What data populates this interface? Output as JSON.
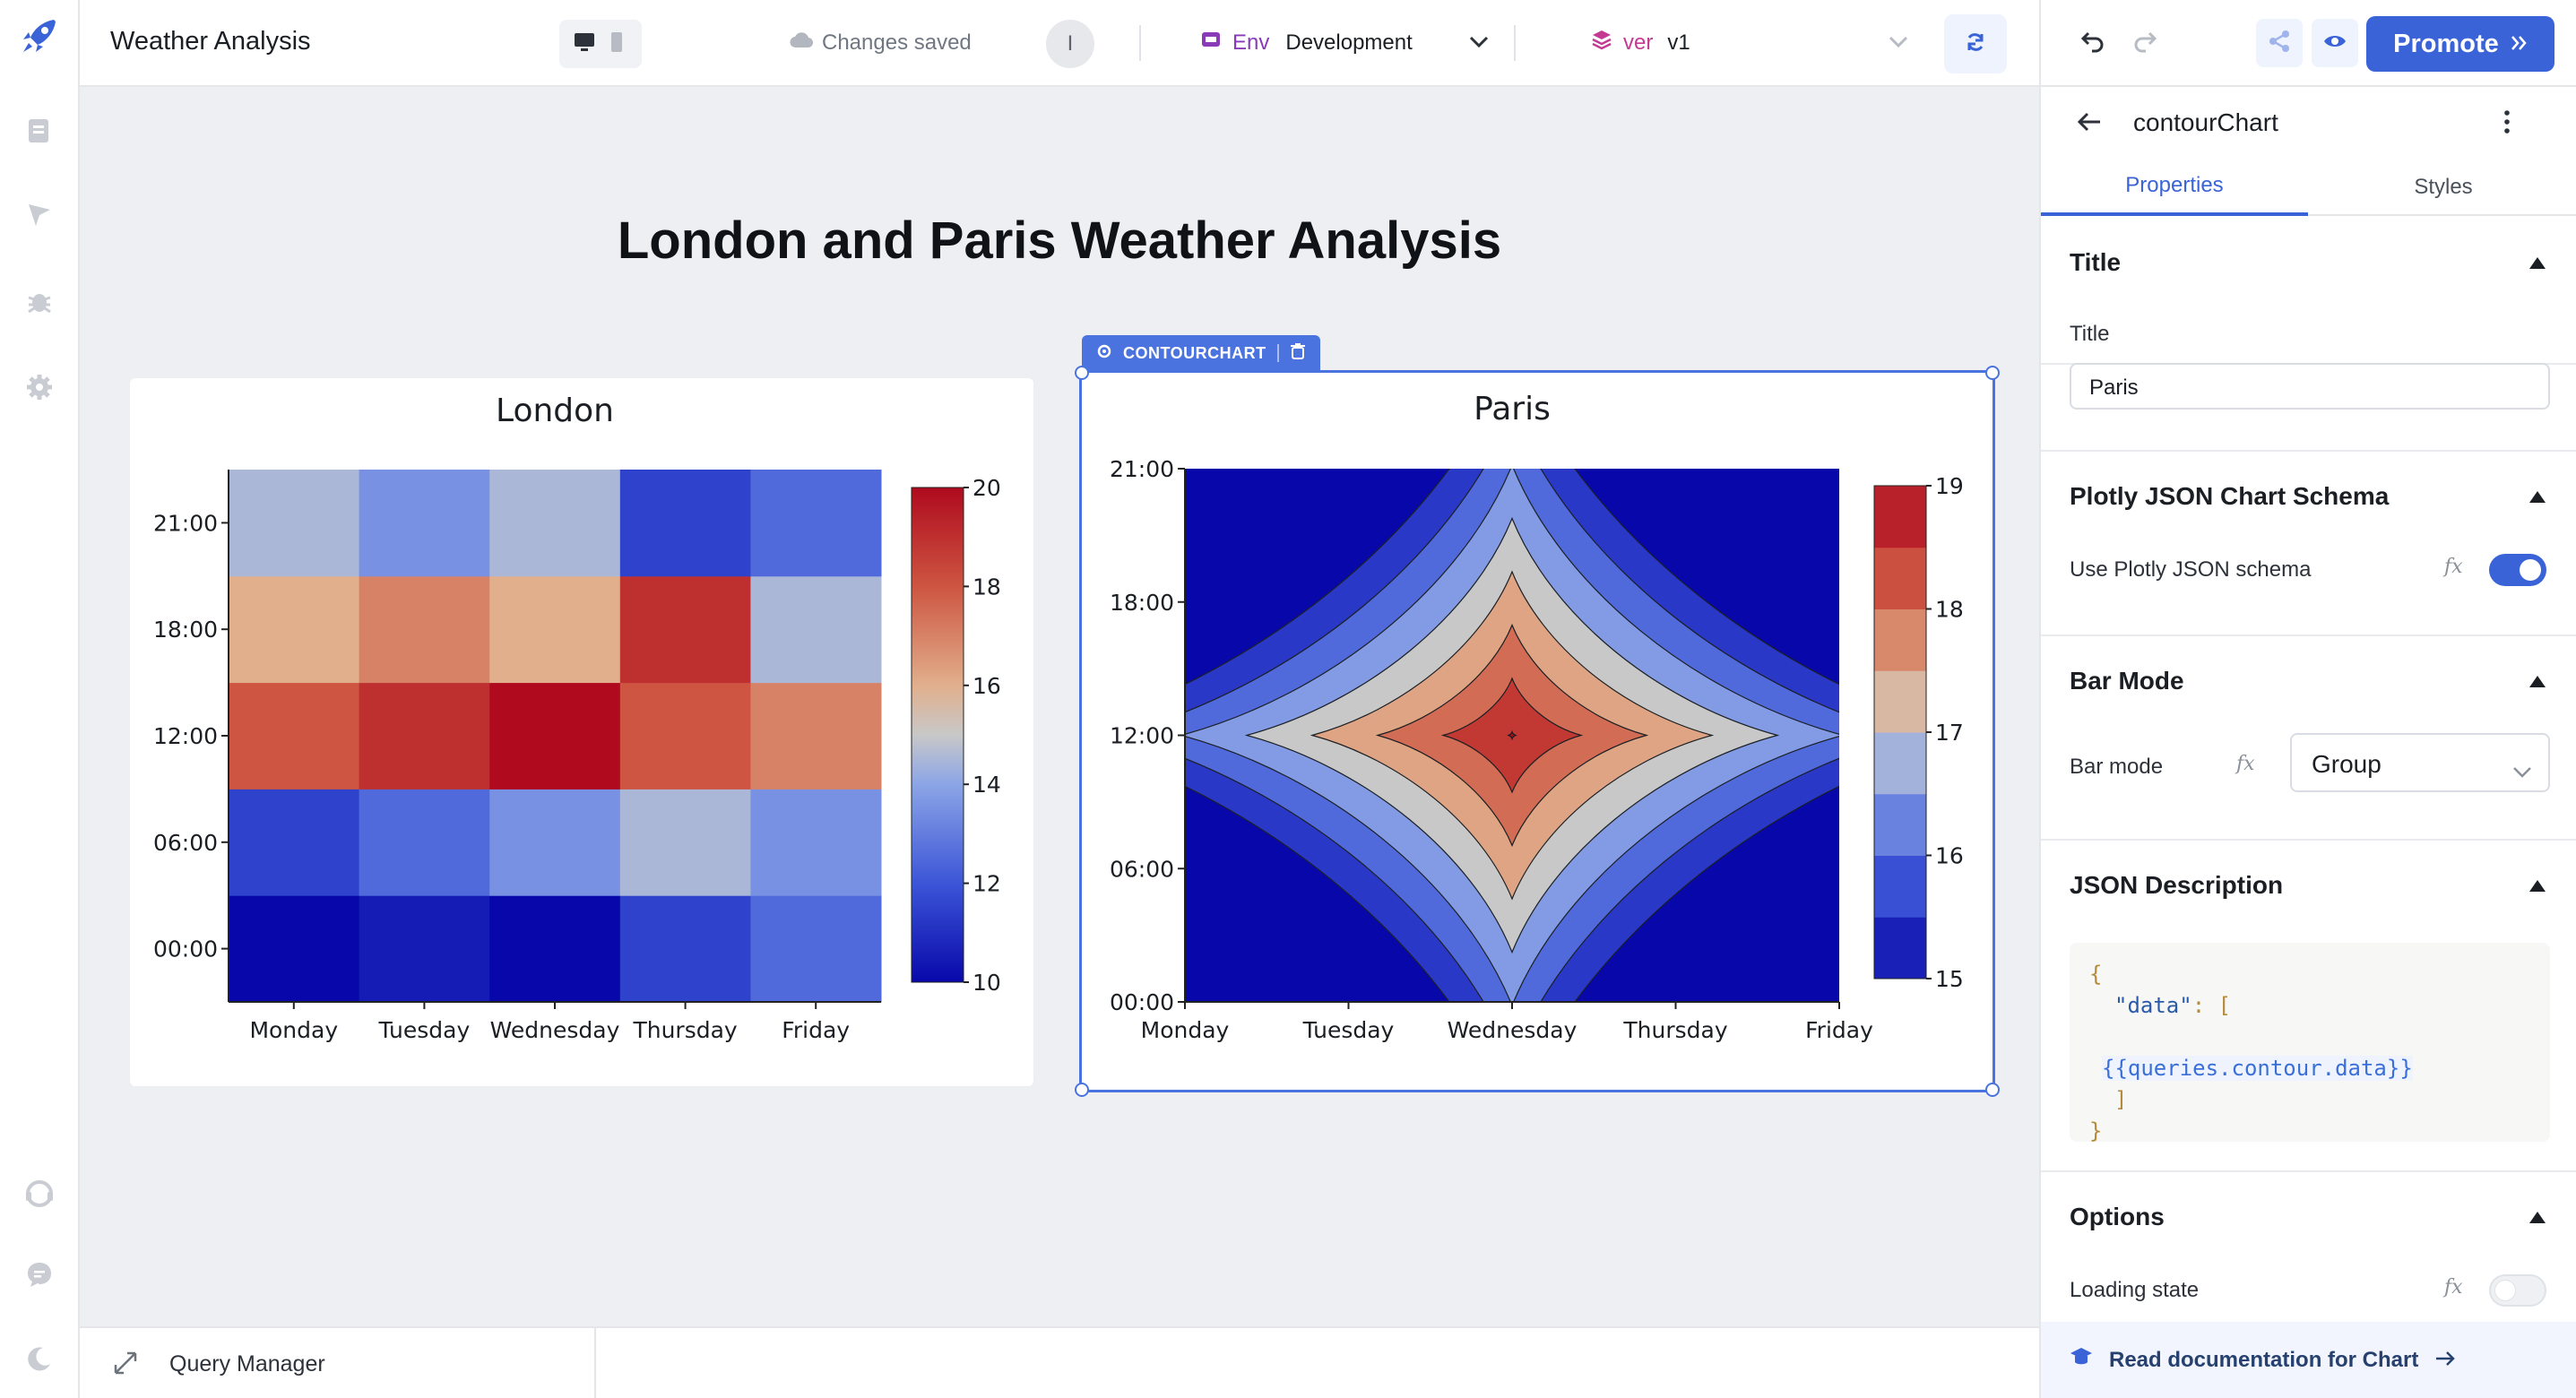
{
  "app": {
    "title": "Weather Analysis",
    "status": "Changes saved",
    "inspect_label": "I",
    "env_tag": "Env",
    "env_value": "Development",
    "version_tag": "ver",
    "version_value": "v1",
    "promote_label": "Promote",
    "accent_color": "#3a63d8"
  },
  "left_rail": {
    "icons": [
      "rocket-logo",
      "pages-icon",
      "queries-icon",
      "debugger-icon",
      "settings-icon",
      "chat-support-icon",
      "comments-icon",
      "dark-mode-icon"
    ]
  },
  "canvas": {
    "page_title": "London and Paris Weather Analysis",
    "component_tag": "CONTOURCHART",
    "query_manager": "Query Manager"
  },
  "chart_data": [
    {
      "type": "heatmap",
      "title": "London",
      "categories": [
        "Monday",
        "Tuesday",
        "Wednesday",
        "Thursday",
        "Friday"
      ],
      "y": [
        "00:00",
        "06:00",
        "12:00",
        "18:00",
        "21:00"
      ],
      "z": [
        [
          10,
          10.5,
          10,
          11.5,
          12.5
        ],
        [
          11.5,
          12.5,
          13.5,
          14.5,
          13.5
        ],
        [
          18,
          19,
          20,
          18,
          17
        ],
        [
          16,
          17,
          16,
          19,
          14.5
        ],
        [
          14.5,
          13.5,
          14.5,
          11.5,
          12.5
        ]
      ],
      "colorbar_ticks": [
        10,
        12,
        14,
        16,
        18,
        20
      ],
      "zlim": [
        10,
        20
      ],
      "colorscale": "Coolwarm"
    },
    {
      "type": "contour",
      "title": "Paris",
      "categories": [
        "Monday",
        "Tuesday",
        "Wednesday",
        "Thursday",
        "Friday"
      ],
      "y": [
        "00:00",
        "06:00",
        "12:00",
        "18:00",
        "21:00"
      ],
      "z": [
        [
          15,
          16,
          17,
          16,
          15
        ],
        [
          16,
          17,
          18,
          17,
          16
        ],
        [
          17,
          18,
          19,
          18,
          17
        ],
        [
          16,
          17,
          18,
          17,
          16
        ],
        [
          15,
          16,
          17,
          16,
          15
        ]
      ],
      "colorbar_ticks": [
        15,
        16,
        17,
        18,
        19
      ],
      "zlim": [
        15,
        19
      ],
      "colorscale": "Coolwarm"
    }
  ],
  "panel": {
    "component_name": "contourChart",
    "tabs": [
      "Properties",
      "Styles"
    ],
    "title_section": {
      "header": "Title",
      "field_label": "Title",
      "field_value": "Paris"
    },
    "schema_section": {
      "header": "Plotly JSON Chart Schema",
      "field_label": "Use Plotly JSON schema",
      "enabled": true
    },
    "barmode_section": {
      "header": "Bar Mode",
      "field_label": "Bar mode",
      "value": "Group"
    },
    "json_section": {
      "header": "JSON Description",
      "line1": "{",
      "line2_key": "\"data\"",
      "line2_rest": ": [",
      "line3": "{{queries.contour.data}}",
      "line4": "]",
      "line5": "}"
    },
    "options_section": {
      "header": "Options",
      "field_label": "Loading state",
      "enabled": false
    },
    "fx_label": "fx",
    "doc_link": "Read documentation for Chart"
  }
}
